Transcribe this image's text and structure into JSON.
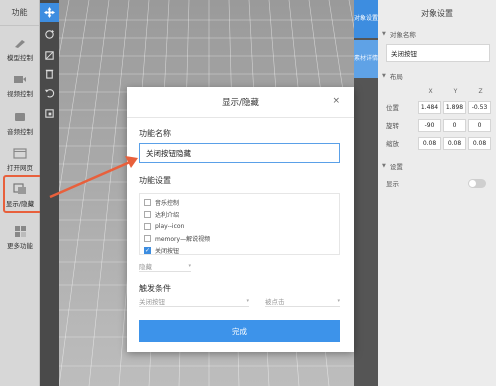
{
  "left_panel": {
    "title": "功能",
    "items": [
      {
        "label": "模型控制",
        "icon": "model-control-icon"
      },
      {
        "label": "视频控制",
        "icon": "video-control-icon"
      },
      {
        "label": "音频控制",
        "icon": "audio-control-icon"
      },
      {
        "label": "打开网页",
        "icon": "open-webpage-icon"
      },
      {
        "label": "显示/隐藏",
        "icon": "show-hide-icon"
      },
      {
        "label": "更多功能",
        "icon": "more-functions-icon"
      }
    ]
  },
  "tools": [
    "move-icon",
    "rotate-icon",
    "scale-icon",
    "delete-icon",
    "undo-icon",
    "crop-icon"
  ],
  "right_tabs": {
    "object_settings": "对象设置",
    "material_details": "素材详情"
  },
  "right_panel": {
    "title": "对象设置",
    "name_section": "对象名称",
    "name_value": "关闭按钮",
    "layout_section": "布局",
    "axes": [
      "X",
      "Y",
      "Z"
    ],
    "rows": [
      {
        "label": "位置",
        "values": [
          "1.484",
          "1.898",
          "-0.53"
        ]
      },
      {
        "label": "旋转",
        "values": [
          "-90",
          "0",
          "0"
        ]
      },
      {
        "label": "缩放",
        "values": [
          "0.08",
          "0.08",
          "0.08"
        ]
      }
    ],
    "settings_section": "设置",
    "display_label": "显示",
    "display_on": false
  },
  "modal": {
    "title": "显示/隐藏",
    "close": "×",
    "func_name_label": "功能名称",
    "func_name_value": "关闭按钮隐藏",
    "func_settings_label": "功能设置",
    "options": [
      {
        "label": "音乐控制",
        "checked": false
      },
      {
        "label": "达利介绍",
        "checked": false
      },
      {
        "label": "play--icon",
        "checked": false
      },
      {
        "label": "memory—解说视频",
        "checked": false
      },
      {
        "label": "关闭按钮",
        "checked": true
      }
    ],
    "visibility_select": "隐藏",
    "trigger_label": "触发条件",
    "trigger_object": "关闭按钮",
    "trigger_event": "被点击",
    "done_button": "完成"
  },
  "colors": {
    "accent": "#3d8de0",
    "annotation": "#e8603c"
  }
}
